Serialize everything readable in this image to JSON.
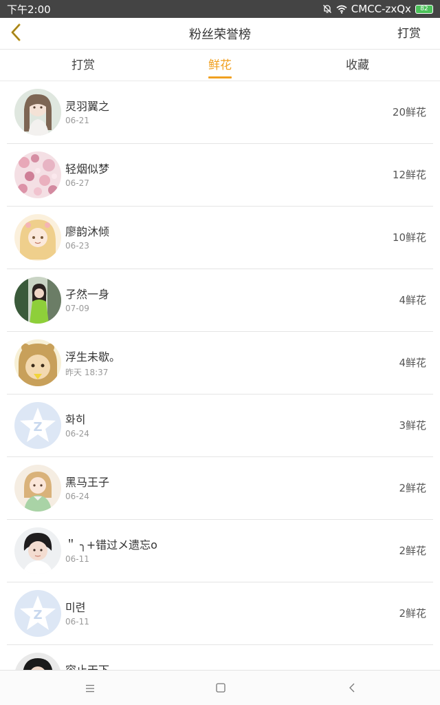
{
  "status_bar": {
    "time": "下午2:00",
    "carrier": "CMCC-zxQx",
    "battery": "82",
    "icons": [
      "mute-bell-icon",
      "wifi-icon",
      "battery-icon"
    ]
  },
  "nav": {
    "back_icon": "chevron-left-icon",
    "title": "粉丝荣誉榜",
    "action": "打赏"
  },
  "tabs": [
    {
      "label": "打赏",
      "active": false
    },
    {
      "label": "鲜花",
      "active": true
    },
    {
      "label": "收藏",
      "active": false
    }
  ],
  "colors": {
    "accent": "#f0a020",
    "status_bar": "#444444",
    "divider": "#e4e4e4"
  },
  "fans": [
    {
      "name": "灵羽翼之",
      "date": "06-21",
      "count": "20鲜花"
    },
    {
      "name": "轻烟似梦",
      "date": "06-27",
      "count": "12鲜花"
    },
    {
      "name": "廖韵沐倾",
      "date": "06-23",
      "count": "10鲜花"
    },
    {
      "name": "孑然一身",
      "date": "07-09",
      "count": "4鲜花"
    },
    {
      "name": "浮生未歇。",
      "date": "昨天 18:37",
      "count": "4鲜花"
    },
    {
      "name": "화히",
      "date": "06-24",
      "count": "3鲜花"
    },
    {
      "name": "黑马王子",
      "date": "06-24",
      "count": "2鲜花"
    },
    {
      "name": "＂ ╮+错过メ遗忘o",
      "date": "06-11",
      "count": "2鲜花"
    },
    {
      "name": "미련",
      "date": "06-11",
      "count": "2鲜花"
    },
    {
      "name": "容止天下",
      "date": "",
      "count": ""
    }
  ],
  "bottom_nav": {
    "icons": [
      "menu-icon",
      "home-square-icon",
      "back-triangle-icon"
    ]
  }
}
